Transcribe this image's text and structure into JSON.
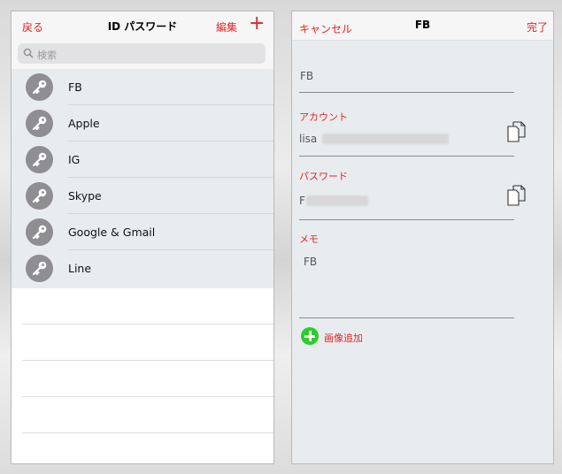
{
  "list_screen": {
    "back_label": "戻る",
    "title": "ID パスワード",
    "edit_label": "編集",
    "add_label": "+",
    "search_placeholder": "検索",
    "entries": [
      "FB",
      "Apple",
      "IG",
      "Skype",
      "Google & Gmail",
      "Line"
    ]
  },
  "detail_screen": {
    "cancel_label": "キャンセル",
    "title": "FB",
    "done_label": "完了",
    "name_value": "FB",
    "account_label": "アカウント",
    "account_value_visible": "lisa",
    "password_label": "パスワード",
    "password_value_visible": "F",
    "memo_label": "メモ",
    "memo_value": "FB",
    "add_image_label": "画像追加"
  },
  "colors": {
    "accent": "#e02626",
    "add_green": "#2ccd2c",
    "key_bg": "#8e8e93"
  }
}
